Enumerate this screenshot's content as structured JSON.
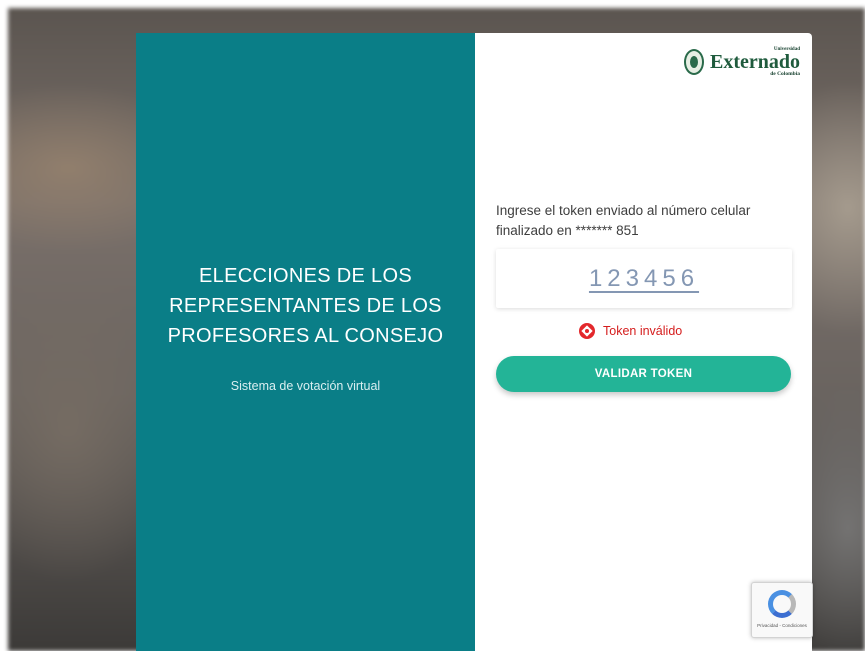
{
  "left_panel": {
    "title": "ELECCIONES DE LOS REPRESENTANTES DE LOS PROFESORES AL CONSEJO",
    "subtitle": "Sistema de votación virtual",
    "color": "#0a7e87"
  },
  "logo": {
    "small_text": "Universidad",
    "main_text": "Externado",
    "sub_text": "de Colombia"
  },
  "token_form": {
    "instructions": "Ingrese el token enviado al número celular finalizado en ******* 851",
    "token_value": "123456",
    "error_message": "Token inválido",
    "error_color": "#d51d1d",
    "submit_label": "VALIDAR TOKEN",
    "submit_color": "#23b497"
  },
  "recaptcha": {
    "links": "Privacidad - Condiciones"
  }
}
